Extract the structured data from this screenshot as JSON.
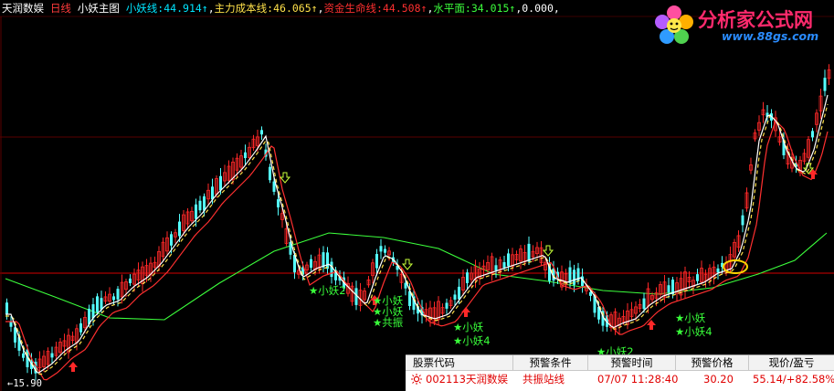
{
  "header": {
    "stock_name": "天润数娱",
    "period": "日线",
    "indicator": "小妖主图",
    "lines": [
      {
        "label": "小妖线:",
        "value": "44.914",
        "arrow": "↑",
        "color": "#00e5ff"
      },
      {
        "label": "主力成本线:",
        "value": "46.065",
        "arrow": "↑",
        "color": "#ffe14a"
      },
      {
        "label": "资金生命线:",
        "value": "44.508",
        "arrow": "↑",
        "color": "#ff3030"
      },
      {
        "label": "水平面:",
        "value": "34.015",
        "arrow": "↑",
        "color": "#3cff3c"
      }
    ],
    "extra_value": "0.000"
  },
  "logo": {
    "title": "分析家公式网",
    "url": "www.88gs.com"
  },
  "chart": {
    "low_price_label": "←15.90",
    "signal_labels": [
      {
        "id": "xiaoyao2-a",
        "text": "★小妖2"
      },
      {
        "id": "gongzhen-a",
        "text": "★小妖\n★小妖\n★共振"
      },
      {
        "id": "xiaoyao-b",
        "text": "★小妖\n★小妖4"
      },
      {
        "id": "xiaoyao2-c",
        "text": "★小妖2"
      },
      {
        "id": "xiaoyao-d",
        "text": "★小妖\n★小妖4"
      }
    ],
    "colors": {
      "up_candle": "#ff2828",
      "down_candle": "#54ffff",
      "xiaoyao_line": "#ffffff",
      "cost_line": "#ffe14a",
      "life_line": "#ff3030",
      "water_line": "#3cff3c",
      "signal": "#39ff3a",
      "price_line": "#d40000",
      "highlight_circle": "#ffd400"
    }
  },
  "alert_panel": {
    "columns": [
      "股票代码",
      "预警条件",
      "预警时间",
      "预警价格",
      "现价/盈亏"
    ],
    "row": {
      "code": "002113",
      "name": "天润数娱",
      "condition": "共振站线",
      "time": "07/07 11:28:40",
      "price": "30.20",
      "profit": "55.14/+82.58%"
    }
  }
}
